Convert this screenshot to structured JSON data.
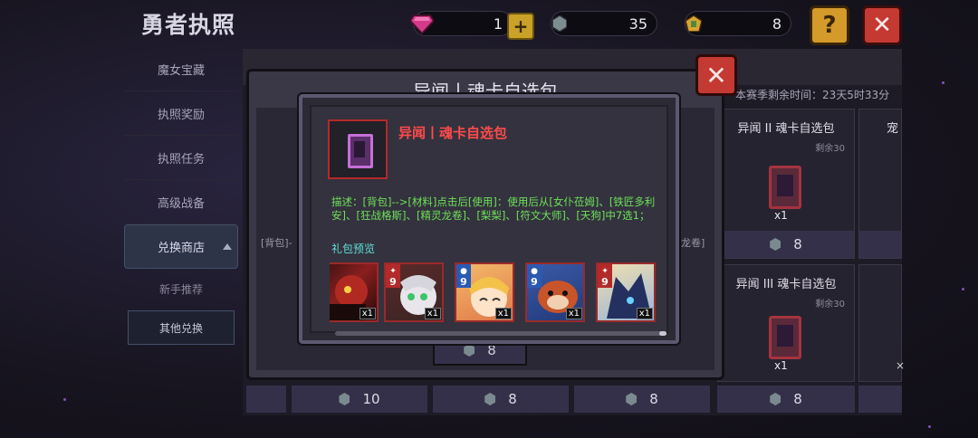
{
  "header": {
    "title": "勇者执照",
    "resources": [
      {
        "icon": "gem-icon",
        "value": "1"
      },
      {
        "icon": "crystal-icon",
        "value": "35"
      },
      {
        "icon": "emblem-icon",
        "value": "8"
      }
    ],
    "help_label": "?",
    "close_label": "✕"
  },
  "sidebar": {
    "items": [
      {
        "label": "魔女宝藏"
      },
      {
        "label": "执照奖励"
      },
      {
        "label": "执照任务"
      },
      {
        "label": "高级战备"
      },
      {
        "label": "兑换商店"
      }
    ],
    "subitems": [
      {
        "label": "新手推荐"
      },
      {
        "label": "其他兑换"
      }
    ]
  },
  "shop": {
    "timer": "本赛季剩余时间：23天5时33分",
    "cards": [
      {
        "title": "异闻 II 魂卡自选包",
        "remain": "剩余30",
        "qty": "x1",
        "price": "8"
      },
      {
        "title": "宠",
        "remain": "",
        "qty": "",
        "price": ""
      },
      {
        "title": "异闻 III 魂卡自选包",
        "remain": "剩余30",
        "qty": "x1",
        "price": "8"
      }
    ],
    "bottom_prices": [
      "10",
      "8",
      "8",
      "8"
    ],
    "mid_price": "8"
  },
  "outer_modal": {
    "title": "异闻丨魂卡自选包",
    "left_fragment": "[背包]-",
    "right_fragment": "龙卷]"
  },
  "modal": {
    "title": "异闻丨魂卡自选包",
    "description": "描述：[背包]-->[材料]点击后[使用]：使用后从[女仆莅姆]、[铁匠多利安]、[狂战格斯]、[精灵龙卷]、[梨梨]、[符文大师]、[天狗]中7选1；",
    "preview_label": "礼包预览",
    "heroes": [
      {
        "level": "9",
        "qty": "x1",
        "element": "fire"
      },
      {
        "level": "9",
        "qty": "x1",
        "element": "fire"
      },
      {
        "level": "9",
        "qty": "x1",
        "element": "water"
      },
      {
        "level": "9",
        "qty": "x1",
        "element": "water"
      },
      {
        "level": "9",
        "qty": "x1",
        "element": "fire"
      }
    ],
    "close_label": "✕"
  }
}
